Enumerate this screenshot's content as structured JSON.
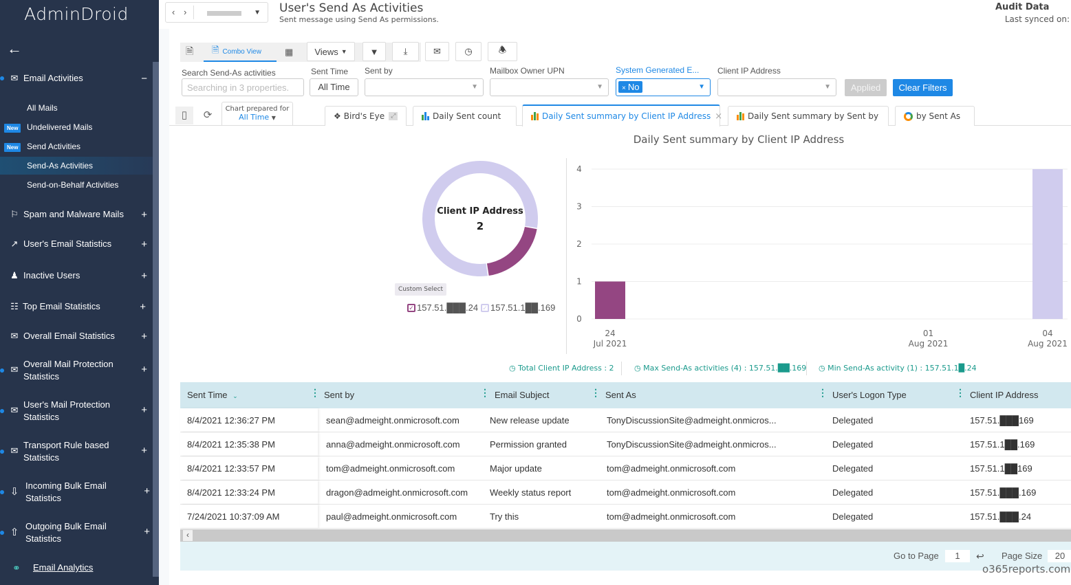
{
  "sidebar": {
    "logo": "AdminDroid",
    "back_icon": "arrow-left-icon",
    "sections": [
      {
        "label": "Email Activities",
        "icon": "envelope-icon",
        "toggle": "−",
        "expanded": true
      },
      {
        "label": "Spam and Malware Mails",
        "icon": "flag-icon",
        "toggle": "+"
      },
      {
        "label": "User's Email Statistics",
        "icon": "line-chart-icon",
        "toggle": "+"
      },
      {
        "label": "Inactive Users",
        "icon": "users-x-icon",
        "toggle": "+"
      },
      {
        "label": "Top Email Statistics",
        "icon": "traffic-light-icon",
        "toggle": "+"
      },
      {
        "label": "Overall Email Statistics",
        "icon": "mail-chart-icon",
        "toggle": "+"
      },
      {
        "label": "Overall Mail Protection Statistics",
        "icon": "mail-shield-icon",
        "toggle": "+"
      },
      {
        "label": "User's Mail Protection Statistics",
        "icon": "mail-shield-user-icon",
        "toggle": "+"
      },
      {
        "label": "Transport Rule based Statistics",
        "icon": "mail-rule-icon",
        "toggle": "+"
      },
      {
        "label": "Incoming Bulk Email Statistics",
        "icon": "inbox-download-icon",
        "toggle": "+"
      },
      {
        "label": "Outgoing Bulk Email Statistics",
        "icon": "inbox-upload-icon",
        "toggle": "+"
      }
    ],
    "subitems": [
      {
        "label": "All Mails",
        "badge": ""
      },
      {
        "label": "Undelivered Mails",
        "badge": "New"
      },
      {
        "label": "Send Activities",
        "badge": "New"
      },
      {
        "label": "Send-As Activities",
        "badge": "",
        "active": true
      },
      {
        "label": "Send-on-Behalf Activities",
        "badge": ""
      }
    ],
    "analytics_link": "Email Analytics"
  },
  "header": {
    "title": "User's Send As Activities",
    "subtitle": "Sent message using Send As permissions.",
    "audit_title": "Audit Data",
    "audit_sub": "Last synced on:"
  },
  "toolbar": {
    "view_tabs": [
      {
        "label": "",
        "icon": "document-icon"
      },
      {
        "label": "Combo View",
        "icon": "combo-view-icon",
        "active": true
      },
      {
        "label": "",
        "icon": "chart-pie-icon"
      }
    ],
    "views_label": "Views",
    "buttons": [
      "filter-icon",
      "download-icon",
      "mail-icon",
      "alarm-clock-icon",
      "bell-icon"
    ]
  },
  "filters": {
    "search_label": "Search Send-As activities",
    "search_placeholder": "Searching in 3 properties.",
    "sent_time_label": "Sent Time",
    "sent_time_value": "All Time",
    "sent_by_label": "Sent by",
    "mailbox_owner_label": "Mailbox Owner UPN",
    "system_generated_label": "System Generated E...",
    "system_generated_chip": "No",
    "client_ip_label": "Client IP Address",
    "applied_label": "Applied",
    "clear_label": "Clear Filters"
  },
  "chart_tabs": {
    "prepared_for_label": "Chart prepared for",
    "prepared_for_value": "All Time",
    "tabs": [
      {
        "label": "Bird's Eye",
        "icon": "bird-icon"
      },
      {
        "label": "Daily Sent count",
        "icon": "bar-chart-icon"
      },
      {
        "label": "Daily Sent summary by Client IP Address",
        "icon": "stacked-bar-icon",
        "active": true
      },
      {
        "label": "Daily Sent summary by Sent by",
        "icon": "stacked-bar-icon"
      },
      {
        "label": "by Sent As",
        "icon": "donut-icon"
      }
    ]
  },
  "chart_data": [
    {
      "type": "pie",
      "subtype": "donut",
      "center_label": "Client IP Address",
      "center_value": "2",
      "slices": [
        {
          "label": "157.51.███.24",
          "value": 1,
          "color": "#944682"
        },
        {
          "label": "157.51.1██.169",
          "value": 4,
          "color": "#d0ccee"
        }
      ],
      "custom_select_label": "Custom Select",
      "legend_placement": "bottom"
    },
    {
      "type": "bar",
      "title": "Daily Sent summary by Client IP Address",
      "x_ticks": [
        {
          "line1": "24",
          "line2": "Jul 2021"
        },
        {
          "line1": "01",
          "line2": "Aug 2021"
        },
        {
          "line1": "04",
          "line2": "Aug 2021"
        }
      ],
      "ylim": [
        0,
        4
      ],
      "y_ticks": [
        0,
        1,
        2,
        3,
        4
      ],
      "grid": true,
      "series": [
        {
          "name": "157.51.███.24",
          "color": "#944682",
          "points": [
            {
              "date": "2021-07-24",
              "value": 1
            }
          ]
        },
        {
          "name": "157.51.1██.169",
          "color": "#d0ccee",
          "points": [
            {
              "date": "2021-08-04",
              "value": 4
            }
          ]
        }
      ],
      "x_range": [
        "2021-07-24",
        "2021-08-04"
      ]
    }
  ],
  "stats": {
    "total_label": "Total Client IP Address",
    "total_value": "2",
    "max_label": "Max Send-As activities (4)",
    "max_value": "157.51.██.169",
    "min_label": "Min Send-As activity (1)",
    "min_value": "157.51.1█.24"
  },
  "table": {
    "columns": [
      "Sent Time",
      "Sent by",
      "Email Subject",
      "Sent As",
      "User's Logon Type",
      "Client IP Address"
    ],
    "rows": [
      [
        "8/4/2021 12:36:27 PM",
        "sean@admeight.onmicrosoft.com",
        "New release update",
        "TonyDiscussionSite@admeight.onmicros...",
        "Delegated",
        "157.51.███169"
      ],
      [
        "8/4/2021 12:35:38 PM",
        "anna@admeight.onmicrosoft.com",
        "Permission granted",
        "TonyDiscussionSite@admeight.onmicros...",
        "Delegated",
        "157.51.1██.169"
      ],
      [
        "8/4/2021 12:33:57 PM",
        "tom@admeight.onmicrosoft.com",
        "Major update",
        "tom@admeight.onmicrosoft.com",
        "Delegated",
        "157.51.1██169"
      ],
      [
        "8/4/2021 12:33:24 PM",
        "dragon@admeight.onmicrosoft.com",
        "Weekly status report",
        "tom@admeight.onmicrosoft.com",
        "Delegated",
        "157.51.███.169"
      ],
      [
        "7/24/2021 10:37:09 AM",
        "paul@admeight.onmicrosoft.com",
        "Try this",
        "tom@admeight.onmicrosoft.com",
        "Delegated",
        "157.51.███.24"
      ]
    ]
  },
  "pagination": {
    "go_to_label": "Go to Page",
    "page_value": "1",
    "page_size_label": "Page Size",
    "page_size_value": "20"
  },
  "watermark": "o365reports.com",
  "colors": {
    "accent": "#1e88e5",
    "sidebar_bg": "#27344b",
    "teal": "#1a9a8c",
    "table_header": "#d2e8ef"
  }
}
